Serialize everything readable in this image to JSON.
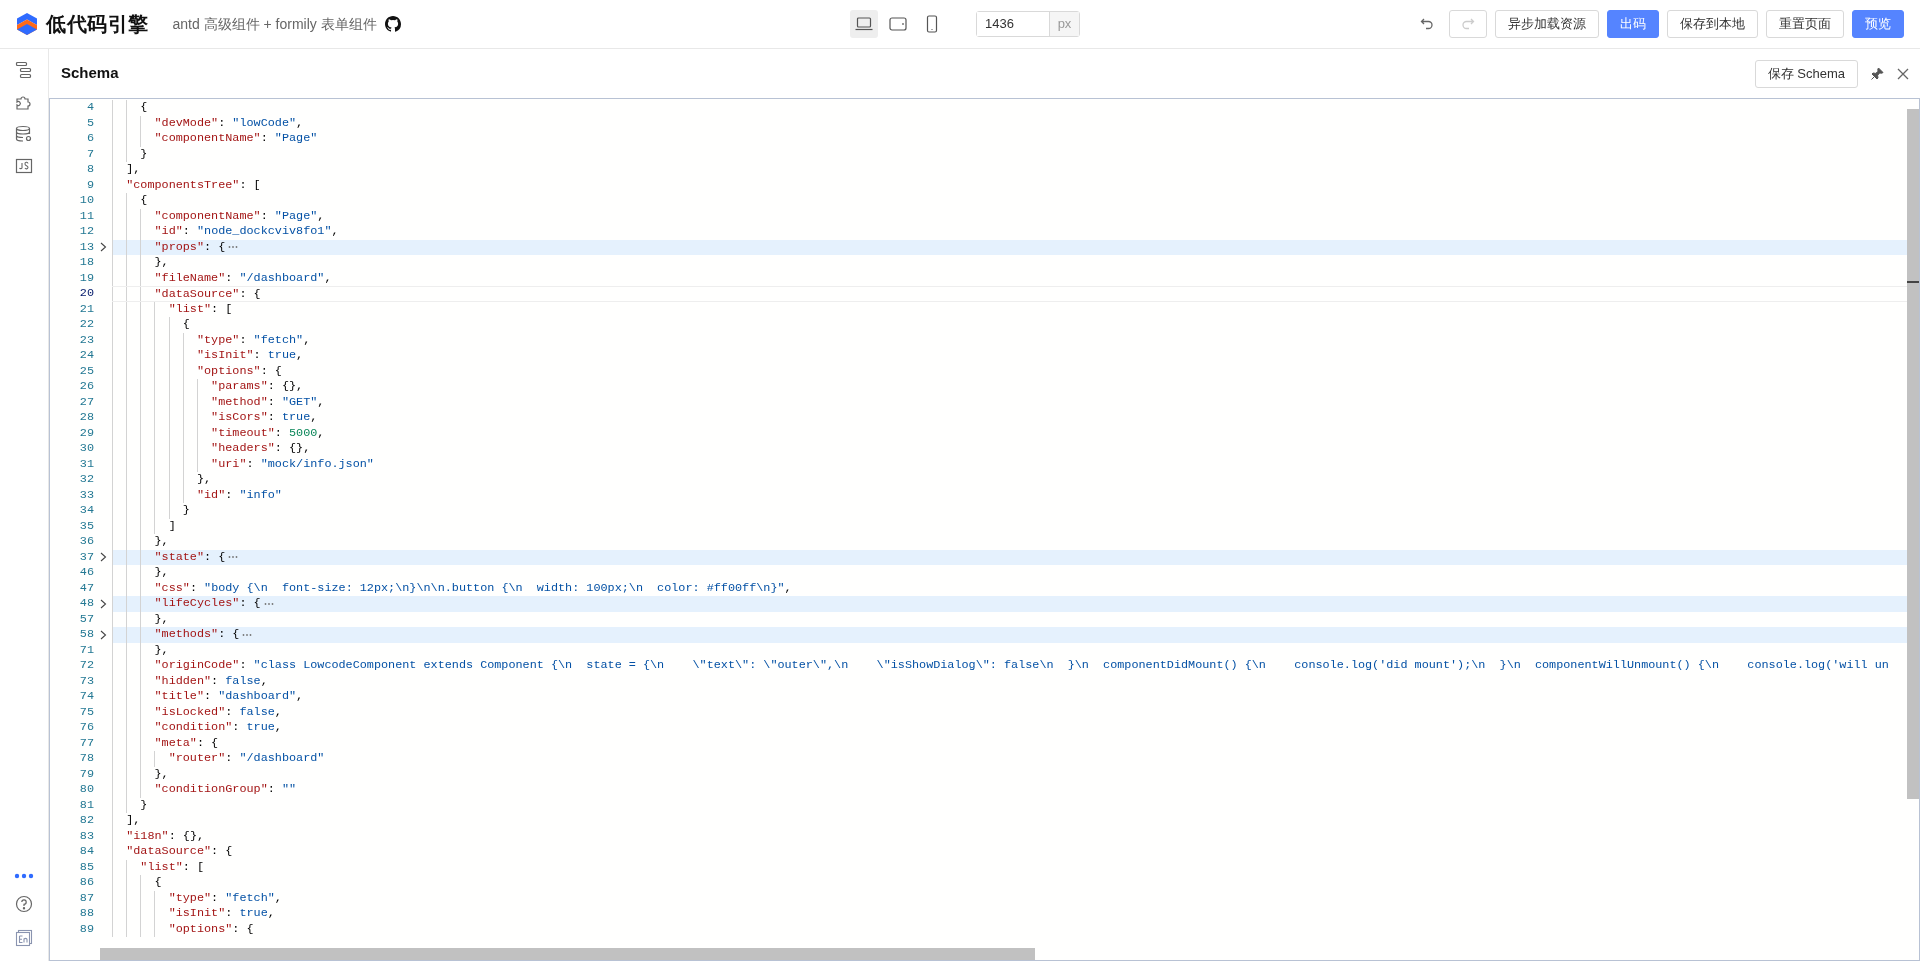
{
  "app": {
    "title": "低代码引擎",
    "subtitle": "antd 高级组件 + formily 表单组件"
  },
  "devices": [
    {
      "kind": "desktop",
      "selected": true
    },
    {
      "kind": "tablet",
      "selected": false
    },
    {
      "kind": "phone",
      "selected": false
    }
  ],
  "canvas_width": {
    "value": "1436",
    "unit": "px"
  },
  "history": {
    "undo_disabled": false,
    "redo_disabled": true
  },
  "actions": [
    {
      "label": "异步加载资源",
      "primary": false
    },
    {
      "label": "出码",
      "primary": true
    },
    {
      "label": "保存到本地",
      "primary": false
    },
    {
      "label": "重置页面",
      "primary": false
    },
    {
      "label": "预览",
      "primary": true
    }
  ],
  "sidebar": {
    "top": [
      {
        "kind": "outline"
      },
      {
        "kind": "components"
      },
      {
        "kind": "datasource"
      },
      {
        "kind": "js"
      }
    ],
    "bottom": [
      {
        "kind": "more"
      },
      {
        "kind": "help"
      },
      {
        "kind": "language"
      }
    ]
  },
  "panel": {
    "title": "Schema",
    "save_button": "保存 Schema"
  },
  "editor": {
    "lines": [
      {
        "number": "4",
        "text": "    {",
        "folded": false,
        "current": false
      },
      {
        "number": "5",
        "text": "      \"devMode\": \"lowCode\",",
        "folded": false,
        "current": false
      },
      {
        "number": "6",
        "text": "      \"componentName\": \"Page\"",
        "folded": false,
        "current": false
      },
      {
        "number": "7",
        "text": "    }",
        "folded": false,
        "current": false
      },
      {
        "number": "8",
        "text": "  ],",
        "folded": false,
        "current": false
      },
      {
        "number": "9",
        "text": "  \"componentsTree\": [",
        "folded": false,
        "current": false
      },
      {
        "number": "10",
        "text": "    {",
        "folded": false,
        "current": false
      },
      {
        "number": "11",
        "text": "      \"componentName\": \"Page\",",
        "folded": false,
        "current": false
      },
      {
        "number": "12",
        "text": "      \"id\": \"node_dockcviv8fo1\",",
        "folded": false,
        "current": false
      },
      {
        "number": "13",
        "text": "      \"props\": {",
        "folded": true,
        "current": false
      },
      {
        "number": "18",
        "text": "      },",
        "folded": false,
        "current": false
      },
      {
        "number": "19",
        "text": "      \"fileName\": \"/dashboard\",",
        "folded": false,
        "current": false
      },
      {
        "number": "20",
        "text": "      \"dataSource\": {",
        "folded": false,
        "current": true
      },
      {
        "number": "21",
        "text": "        \"list\": [",
        "folded": false,
        "current": false
      },
      {
        "number": "22",
        "text": "          {",
        "folded": false,
        "current": false
      },
      {
        "number": "23",
        "text": "            \"type\": \"fetch\",",
        "folded": false,
        "current": false
      },
      {
        "number": "24",
        "text": "            \"isInit\": true,",
        "folded": false,
        "current": false
      },
      {
        "number": "25",
        "text": "            \"options\": {",
        "folded": false,
        "current": false
      },
      {
        "number": "26",
        "text": "              \"params\": {},",
        "folded": false,
        "current": false
      },
      {
        "number": "27",
        "text": "              \"method\": \"GET\",",
        "folded": false,
        "current": false
      },
      {
        "number": "28",
        "text": "              \"isCors\": true,",
        "folded": false,
        "current": false
      },
      {
        "number": "29",
        "text": "              \"timeout\": 5000,",
        "folded": false,
        "current": false
      },
      {
        "number": "30",
        "text": "              \"headers\": {},",
        "folded": false,
        "current": false
      },
      {
        "number": "31",
        "text": "              \"uri\": \"mock/info.json\"",
        "folded": false,
        "current": false
      },
      {
        "number": "32",
        "text": "            },",
        "folded": false,
        "current": false
      },
      {
        "number": "33",
        "text": "            \"id\": \"info\"",
        "folded": false,
        "current": false
      },
      {
        "number": "34",
        "text": "          }",
        "folded": false,
        "current": false
      },
      {
        "number": "35",
        "text": "        ]",
        "folded": false,
        "current": false
      },
      {
        "number": "36",
        "text": "      },",
        "folded": false,
        "current": false
      },
      {
        "number": "37",
        "text": "      \"state\": {",
        "folded": true,
        "current": false
      },
      {
        "number": "46",
        "text": "      },",
        "folded": false,
        "current": false
      },
      {
        "number": "47",
        "text": "      \"css\": \"body {\\n  font-size: 12px;\\n}\\n\\n.button {\\n  width: 100px;\\n  color: #ff00ff\\n}\",",
        "folded": false,
        "current": false
      },
      {
        "number": "48",
        "text": "      \"lifeCycles\": {",
        "folded": true,
        "current": false
      },
      {
        "number": "57",
        "text": "      },",
        "folded": false,
        "current": false
      },
      {
        "number": "58",
        "text": "      \"methods\": {",
        "folded": true,
        "current": false
      },
      {
        "number": "71",
        "text": "      },",
        "folded": false,
        "current": false
      },
      {
        "number": "72",
        "text": "      \"originCode\": \"class LowcodeComponent extends Component {\\n  state = {\\n    \\\"text\\\": \\\"outer\\\",\\n    \\\"isShowDialog\\\": false\\n  }\\n  componentDidMount() {\\n    console.log('did mount');\\n  }\\n  componentWillUnmount() {\\n    console.log('will un",
        "folded": false,
        "current": false
      },
      {
        "number": "73",
        "text": "      \"hidden\": false,",
        "folded": false,
        "current": false
      },
      {
        "number": "74",
        "text": "      \"title\": \"dashboard\",",
        "folded": false,
        "current": false
      },
      {
        "number": "75",
        "text": "      \"isLocked\": false,",
        "folded": false,
        "current": false
      },
      {
        "number": "76",
        "text": "      \"condition\": true,",
        "folded": false,
        "current": false
      },
      {
        "number": "77",
        "text": "      \"meta\": {",
        "folded": false,
        "current": false
      },
      {
        "number": "78",
        "text": "        \"router\": \"/dashboard\"",
        "folded": false,
        "current": false
      },
      {
        "number": "79",
        "text": "      },",
        "folded": false,
        "current": false
      },
      {
        "number": "80",
        "text": "      \"conditionGroup\": \"\"",
        "folded": false,
        "current": false
      },
      {
        "number": "81",
        "text": "    }",
        "folded": false,
        "current": false
      },
      {
        "number": "82",
        "text": "  ],",
        "folded": false,
        "current": false
      },
      {
        "number": "83",
        "text": "  \"i18n\": {},",
        "folded": false,
        "current": false
      },
      {
        "number": "84",
        "text": "  \"dataSource\": {",
        "folded": false,
        "current": false
      },
      {
        "number": "85",
        "text": "    \"list\": [",
        "folded": false,
        "current": false
      },
      {
        "number": "86",
        "text": "      {",
        "folded": false,
        "current": false
      },
      {
        "number": "87",
        "text": "        \"type\": \"fetch\",",
        "folded": false,
        "current": false
      },
      {
        "number": "88",
        "text": "        \"isInit\": true,",
        "folded": false,
        "current": false
      },
      {
        "number": "89",
        "text": "        \"options\": {",
        "folded": false,
        "current": false
      }
    ]
  }
}
